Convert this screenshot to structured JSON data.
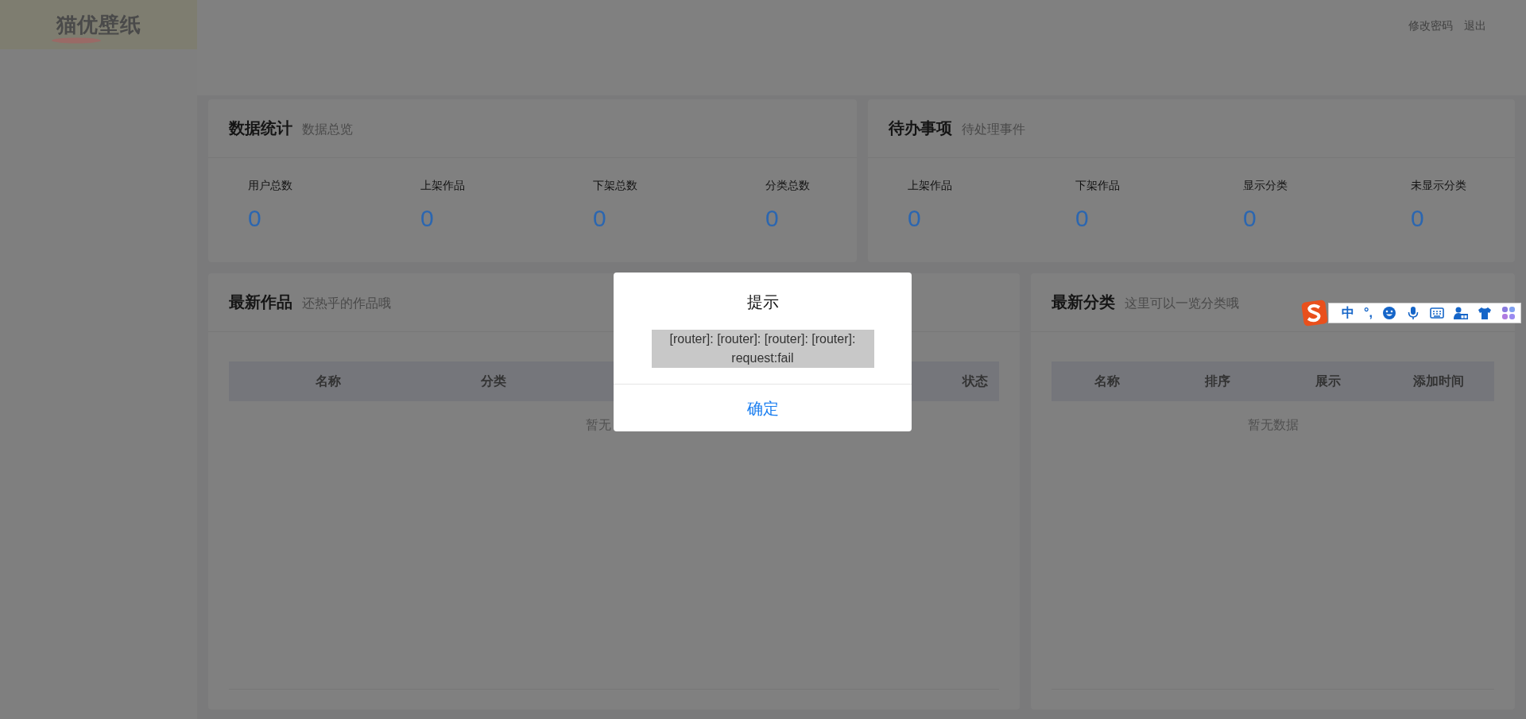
{
  "header": {
    "logo": "猫优壁纸",
    "links": [
      "修改密码",
      "退出"
    ]
  },
  "stats_panel": {
    "title": "数据统计",
    "subtitle": "数据总览",
    "items": [
      {
        "label": "用户总数",
        "value": "0"
      },
      {
        "label": "上架作品",
        "value": "0"
      },
      {
        "label": "下架总数",
        "value": "0"
      },
      {
        "label": "分类总数",
        "value": "0"
      }
    ]
  },
  "todo_panel": {
    "title": "待办事项",
    "subtitle": "待处理事件",
    "items": [
      {
        "label": "上架作品",
        "value": "0"
      },
      {
        "label": "下架作品",
        "value": "0"
      },
      {
        "label": "显示分类",
        "value": "0"
      },
      {
        "label": "未显示分类",
        "value": "0"
      }
    ]
  },
  "works_panel": {
    "title": "最新作品",
    "subtitle": "还热乎的作品哦",
    "columns": [
      "名称",
      "分类",
      "状态"
    ],
    "empty_text": "暂无"
  },
  "category_panel": {
    "title": "最新分类",
    "subtitle": "这里可以一览分类哦",
    "columns": [
      "名称",
      "排序",
      "展示",
      "添加时间"
    ],
    "empty_text": "暂无数据"
  },
  "dialog": {
    "title": "提示",
    "message": "[router]: [router]: [router]: [router]: request:fail",
    "button": "确定"
  },
  "ime_toolbar": {
    "items": [
      {
        "kind": "logo"
      },
      {
        "kind": "text",
        "label": "中"
      },
      {
        "kind": "text",
        "label": "°,"
      },
      {
        "kind": "smiley"
      },
      {
        "kind": "mic"
      },
      {
        "kind": "keyboard"
      },
      {
        "kind": "user"
      },
      {
        "kind": "shirt"
      },
      {
        "kind": "clover"
      }
    ]
  }
}
